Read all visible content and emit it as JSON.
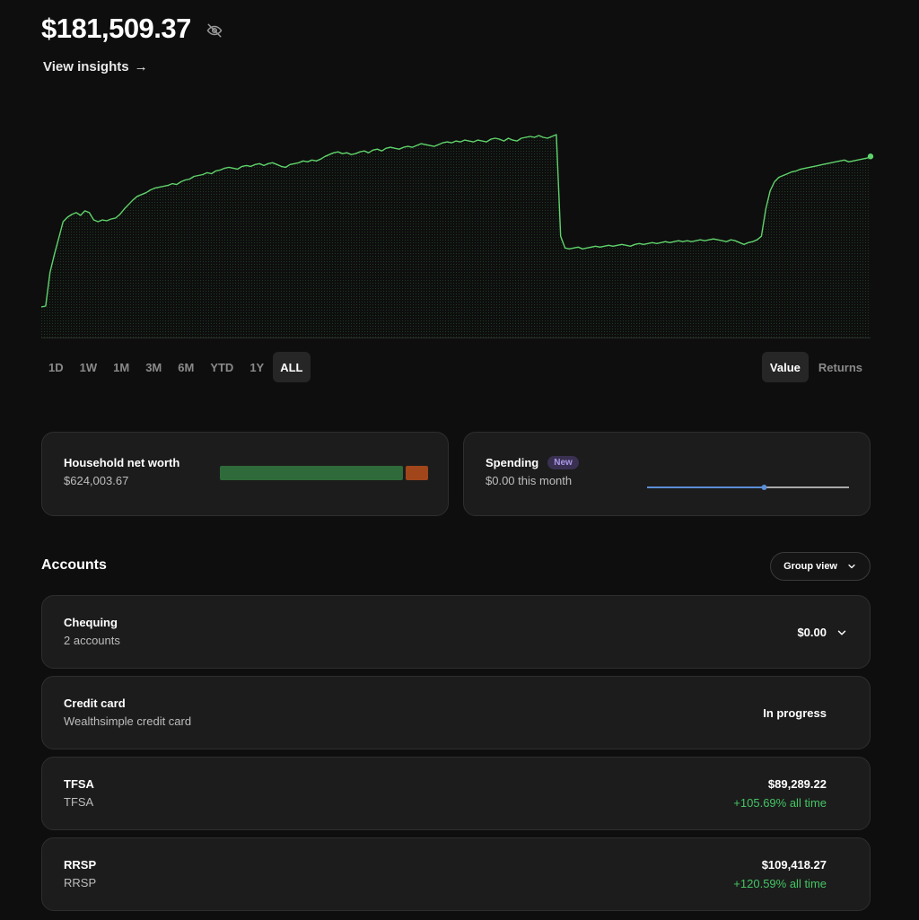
{
  "header": {
    "balance": "$181,509.37",
    "insights_label": "View insights",
    "insights_arrow": "→"
  },
  "ranges": [
    "1D",
    "1W",
    "1M",
    "3M",
    "6M",
    "YTD",
    "1Y",
    "ALL"
  ],
  "active_range": "ALL",
  "mode": {
    "value_label": "Value",
    "returns_label": "Returns",
    "active": "Value"
  },
  "chart_data": {
    "type": "line",
    "x": [
      0,
      1,
      2,
      3,
      4,
      5,
      6,
      7,
      8,
      9,
      10,
      11,
      12,
      13,
      14,
      15,
      16,
      17,
      18,
      19,
      20,
      21,
      22,
      23,
      24,
      25,
      26,
      27,
      28,
      29,
      30,
      31,
      32,
      33,
      34,
      35,
      36,
      37,
      38,
      39,
      40,
      41,
      42,
      43,
      44,
      45,
      46,
      47,
      48,
      49,
      50,
      51,
      52,
      53,
      54,
      55,
      56,
      57,
      58,
      59,
      60,
      61,
      62,
      63,
      64,
      65,
      66,
      67,
      68,
      69,
      70,
      71,
      72,
      73,
      74,
      75,
      76,
      77,
      78,
      79,
      80,
      81,
      82,
      83,
      84,
      85,
      86,
      87,
      88,
      89,
      90,
      91,
      92,
      93,
      94,
      95,
      96,
      97,
      98,
      99,
      100,
      101,
      102,
      103,
      104,
      105,
      106,
      107,
      108,
      109,
      110,
      111,
      112,
      113,
      114,
      115,
      116,
      117,
      118,
      119,
      120,
      121,
      122,
      123,
      124,
      125,
      126,
      127,
      128,
      129,
      130,
      131,
      132,
      133,
      134,
      135,
      136,
      137,
      138,
      139,
      140,
      141,
      142,
      143,
      144,
      145,
      146,
      147,
      148,
      149,
      150,
      151,
      152,
      153,
      154,
      155,
      156,
      157,
      158,
      159,
      160,
      161,
      162,
      163,
      164,
      165,
      166,
      167,
      168,
      169,
      170,
      171,
      172,
      173,
      174,
      175,
      176,
      177,
      178,
      179,
      180,
      181,
      182,
      183,
      184,
      185,
      186,
      187,
      188,
      189,
      190
    ],
    "values": [
      2,
      3,
      40,
      60,
      78,
      96,
      101,
      104,
      106,
      103,
      108,
      106,
      98,
      96,
      98,
      97,
      99,
      100,
      104,
      110,
      115,
      120,
      124,
      126,
      128,
      131,
      133,
      134,
      135,
      136,
      138,
      137,
      140,
      142,
      143,
      146,
      147,
      148,
      150,
      149,
      152,
      153,
      155,
      156,
      155,
      154,
      157,
      158,
      157,
      159,
      160,
      158,
      160,
      161,
      159,
      157,
      156,
      159,
      160,
      161,
      163,
      162,
      164,
      163,
      165,
      168,
      170,
      172,
      173,
      171,
      172,
      170,
      171,
      173,
      174,
      172,
      175,
      176,
      174,
      177,
      178,
      177,
      176,
      178,
      179,
      178,
      180,
      182,
      181,
      180,
      179,
      181,
      183,
      184,
      183,
      185,
      184,
      186,
      185,
      184,
      186,
      185,
      184,
      187,
      188,
      187,
      185,
      188,
      186,
      185,
      188,
      189,
      190,
      189,
      191,
      189,
      188,
      190,
      192,
      80,
      67,
      66,
      67,
      68,
      66,
      67,
      68,
      69,
      68,
      69,
      70,
      69,
      70,
      71,
      70,
      69,
      71,
      72,
      71,
      72,
      73,
      72,
      73,
      74,
      73,
      74,
      75,
      74,
      75,
      74,
      75,
      76,
      75,
      76,
      77,
      76,
      75,
      74,
      76,
      75,
      73,
      71,
      73,
      74,
      76,
      80,
      110,
      130,
      140,
      145,
      147,
      149,
      151,
      152,
      154,
      155,
      156,
      157,
      158,
      159,
      160,
      161,
      162,
      163,
      164,
      162,
      163,
      164,
      165,
      166,
      167,
      166,
      167,
      168
    ],
    "title": "",
    "xlabel": "",
    "ylabel": "",
    "color": "#5fd36b",
    "grid": false
  },
  "networth": {
    "title": "Household net worth",
    "value": "$624,003.67",
    "colors": [
      "#2f6b3a",
      "#a0461a"
    ],
    "shares": [
      0.89,
      0.11
    ]
  },
  "spending": {
    "title": "Spending",
    "badge": "New",
    "subtitle": "$0.00 this month",
    "line_color": "#5b8ed6",
    "progress": 0.58
  },
  "accounts": {
    "title": "Accounts",
    "group_view_label": "Group view",
    "items": [
      {
        "name": "Chequing",
        "sub": "2 accounts",
        "amount": "$0.00",
        "gain": "",
        "expandable": true
      },
      {
        "name": "Credit card",
        "sub": "Wealthsimple credit card",
        "amount": "In progress",
        "gain": "",
        "expandable": false
      },
      {
        "name": "TFSA",
        "sub": "TFSA",
        "amount": "$89,289.22",
        "gain": "+105.69% all time",
        "expandable": false
      },
      {
        "name": "RRSP",
        "sub": "RRSP",
        "amount": "$109,418.27",
        "gain": "+120.59% all time",
        "expandable": false
      }
    ]
  }
}
